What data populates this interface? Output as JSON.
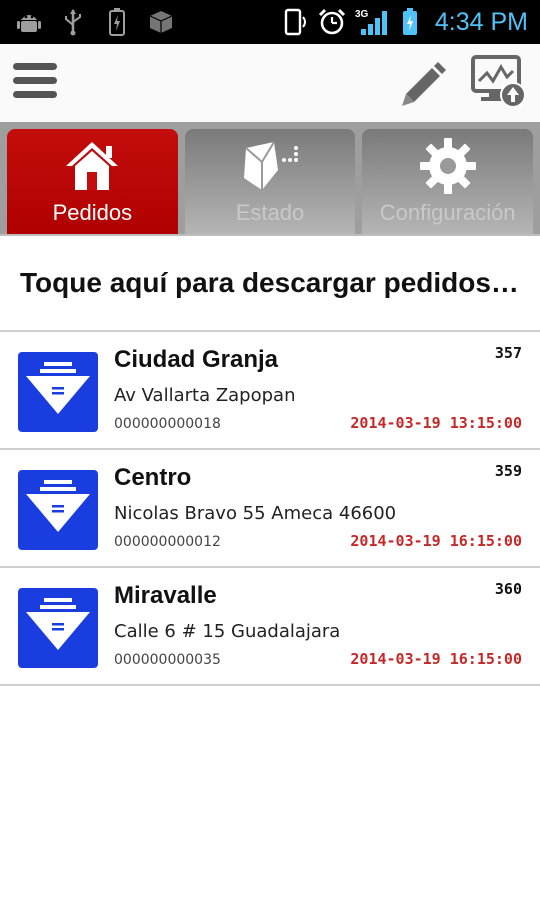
{
  "status_bar": {
    "time": "4:34 PM",
    "network": "3G",
    "icons": [
      "android-debug-icon",
      "usb-icon",
      "battery-charging-icon",
      "package-icon",
      "phone-orientation-icon",
      "alarm-icon",
      "signal-icon",
      "battery-icon"
    ]
  },
  "action_bar": {
    "icons": [
      "menu-icon",
      "edit-icon",
      "sync-monitor-icon"
    ]
  },
  "tabs": [
    {
      "label": "Pedidos",
      "icon": "home-icon",
      "active": true
    },
    {
      "label": "Estado",
      "icon": "box-status-icon",
      "active": false
    },
    {
      "label": "Configuración",
      "icon": "gear-icon",
      "active": false
    }
  ],
  "download_prompt": "Toque aquí para descargar pedidos…",
  "orders": [
    {
      "name": "Ciudad Granja",
      "number": "357",
      "address": "Av Vallarta Zapopan",
      "code": "000000000018",
      "date": "2014-03-19 13:15:00"
    },
    {
      "name": "Centro",
      "number": "359",
      "address": "Nicolas Bravo 55 Ameca 46600",
      "code": "000000000012",
      "date": "2014-03-19 16:15:00"
    },
    {
      "name": "Miravalle",
      "number": "360",
      "address": "Calle 6 # 15 Guadalajara",
      "code": "000000000035",
      "date": "2014-03-19 16:15:00"
    }
  ],
  "colors": {
    "active_tab": "#c40d0d",
    "inactive_tab": "#9a9a9a",
    "order_icon": "#1a3de0",
    "date_text": "#c62828",
    "status_accent": "#4fc3f7"
  }
}
